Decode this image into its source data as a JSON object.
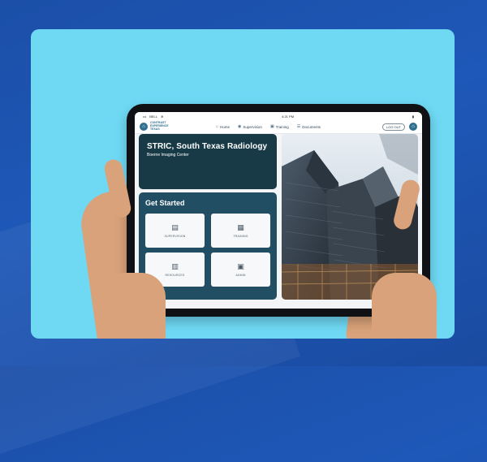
{
  "device": {
    "carrier": "BELL",
    "time": "4:21 PM"
  },
  "navbar": {
    "logo_text_1": "CONTRAST",
    "logo_text_2": "EXPERIENCE",
    "logo_text_3": "TEXAS",
    "links": [
      {
        "label": "Home",
        "icon": "home-icon"
      },
      {
        "label": "Supervision",
        "icon": "eye-icon"
      },
      {
        "label": "Training",
        "icon": "training-icon"
      },
      {
        "label": "Documents",
        "icon": "documents-icon"
      }
    ],
    "logout_label": "LOG OUT"
  },
  "facility": {
    "name": "STRIC, South Texas Radiology",
    "location": "Boerne Imaging Center"
  },
  "get_started": {
    "title": "Get Started",
    "tiles": [
      {
        "label": "SUPERVISION",
        "icon": "supervision-icon"
      },
      {
        "label": "TRAINING",
        "icon": "training-icon"
      },
      {
        "label": "RESOURCES",
        "icon": "resources-icon"
      },
      {
        "label": "ADMIN",
        "icon": "admin-icon"
      }
    ]
  },
  "colors": {
    "page_bg": "#1e58b8",
    "card_bg": "#6fd9f4",
    "facility_bg": "#173a46",
    "panel_bg": "#214e62",
    "brand": "#2f6f8f"
  }
}
